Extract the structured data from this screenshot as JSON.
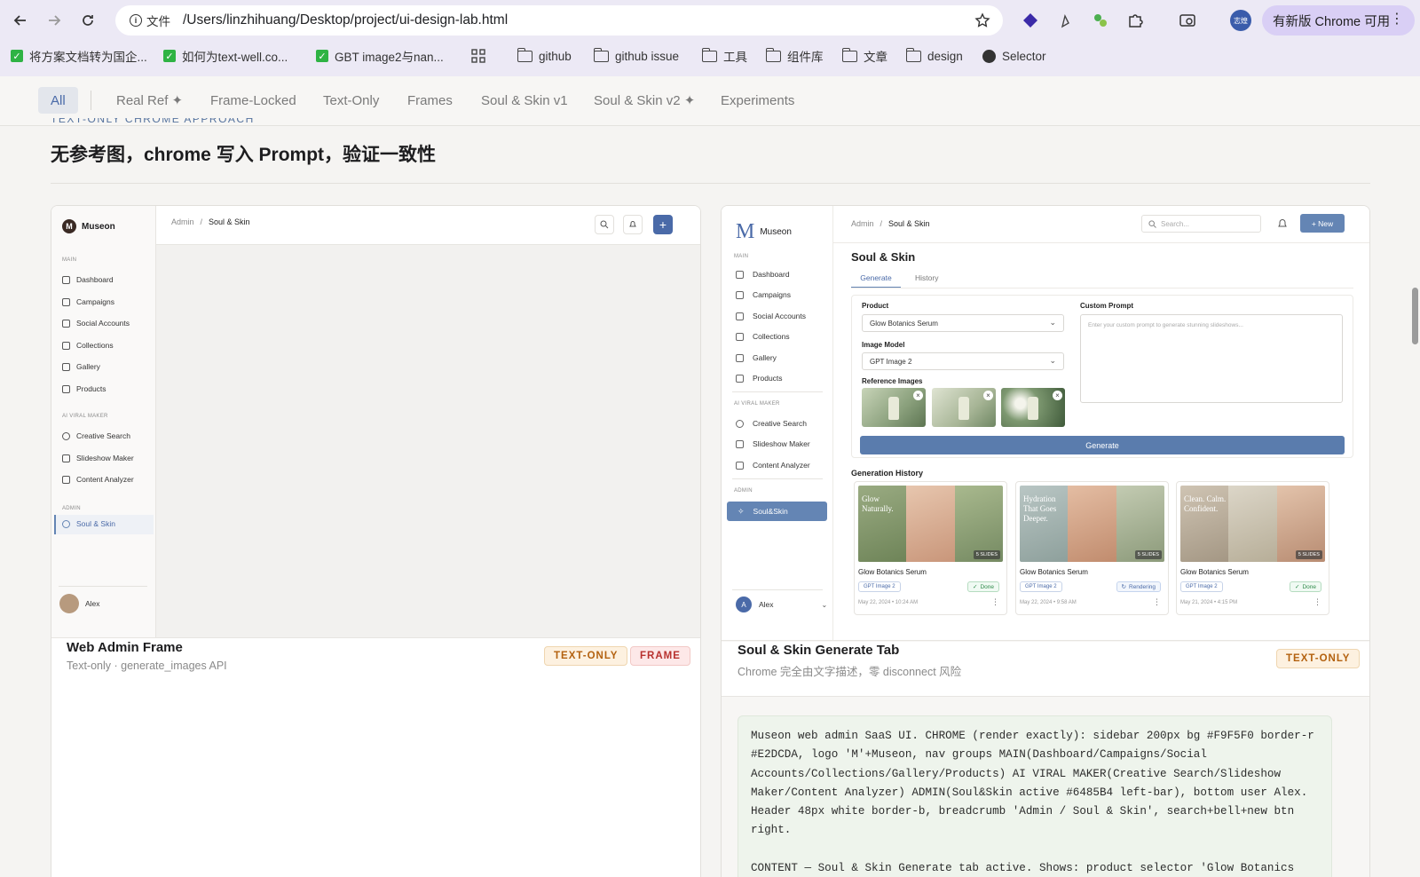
{
  "browser": {
    "info_label": "文件",
    "url": "/Users/linzhihuang/Desktop/project/ui-design-lab.html",
    "profile_initials": "志煌",
    "update_label": "有新版 Chrome 可用",
    "bookmarks": [
      {
        "label": "将方案文档转为国企...",
        "icon": "check-icon"
      },
      {
        "label": "如何为text-well.co...",
        "icon": "check-icon"
      },
      {
        "label": "GBT image2与nan...",
        "icon": "check-icon"
      },
      {
        "label": "github",
        "icon": "folder-icon"
      },
      {
        "label": "github issue",
        "icon": "folder-icon"
      },
      {
        "label": "工具",
        "icon": "folder-icon"
      },
      {
        "label": "组件库",
        "icon": "folder-icon"
      },
      {
        "label": "文章",
        "icon": "folder-icon"
      },
      {
        "label": "design",
        "icon": "folder-icon"
      },
      {
        "label": "Selector",
        "icon": "globe-icon"
      }
    ]
  },
  "filters": {
    "active": "All",
    "tabs": [
      "All",
      "Real Ref ✦",
      "Frame-Locked",
      "Text-Only",
      "Frames",
      "Soul & Skin v1",
      "Soul & Skin v2 ✦",
      "Experiments"
    ]
  },
  "section": {
    "eyebrow": "TEXT-ONLY CHROME APPROACH",
    "title": "无参考图，chrome 写入 Prompt，验证一致性"
  },
  "card1": {
    "title": "Web Admin Frame",
    "subtitle": "Text-only · generate_images API",
    "badges": [
      "TEXT-ONLY",
      "FRAME"
    ],
    "frame": {
      "logo_letter": "M",
      "logo": "Museon",
      "breadcrumb": [
        "Admin",
        "/",
        "Soul & Skin"
      ],
      "group_main": "MAIN",
      "main_items": [
        "Dashboard",
        "Campaigns",
        "Social Accounts",
        "Collections",
        "Gallery",
        "Products"
      ],
      "group_ai": "AI VIRAL MAKER",
      "ai_items": [
        "Creative Search",
        "Slideshow Maker",
        "Content Analyzer"
      ],
      "group_admin": "ADMIN",
      "admin_item": "Soul & Skin",
      "user": "Alex"
    }
  },
  "card2": {
    "title": "Soul & Skin Generate Tab",
    "subtitle": "Chrome 完全由文字描述，零 disconnect 风险",
    "badge": "TEXT-ONLY",
    "frame": {
      "logo_letter": "M",
      "logo": "Museon",
      "breadcrumb": [
        "Admin",
        "/",
        "Soul & Skin"
      ],
      "search_placeholder": "Search...",
      "new_button": "+ New",
      "group_main": "MAIN",
      "main_items": [
        "Dashboard",
        "Campaigns",
        "Social Accounts",
        "Collections",
        "Gallery",
        "Products"
      ],
      "group_ai": "AI VIRAL MAKER",
      "ai_items": [
        "Creative Search",
        "Slideshow Maker",
        "Content Analyzer"
      ],
      "group_admin": "ADMIN",
      "admin_item": "Soul&Skin",
      "user_initial": "A",
      "user": "Alex",
      "page_title": "Soul & Skin",
      "tabs": [
        "Generate",
        "History"
      ],
      "product_label": "Product",
      "product_value": "Glow Botanics Serum",
      "model_label": "Image Model",
      "model_value": "GPT Image 2",
      "ref_label": "Reference Images",
      "prompt_label": "Custom Prompt",
      "prompt_placeholder": "Enter your custom prompt to generate stunning slideshows...",
      "generate": "Generate",
      "history_title": "Generation History",
      "history": [
        {
          "overlay": "Glow Naturally.",
          "name": "Glow Botanics Serum",
          "model": "GPT Image 2",
          "status": "Done",
          "date": "May 22, 2024 • 10:24 AM",
          "slides": "5 SLIDES"
        },
        {
          "overlay": "Hydration That Goes Deeper.",
          "name": "Glow Botanics Serum",
          "model": "GPT Image 2",
          "status": "Rendering",
          "date": "May 22, 2024 • 9:58 AM",
          "slides": "5 SLIDES"
        },
        {
          "overlay": "Clean. Calm. Confident.",
          "name": "Glow Botanics Serum",
          "model": "GPT Image 2",
          "status": "Done",
          "date": "May 21, 2024 • 4:15 PM",
          "slides": "5 SLIDES"
        }
      ]
    },
    "prompt_text": "Museon web admin SaaS UI. CHROME (render exactly): sidebar 200px bg #F9F5F0 border-r #E2DCDA, logo 'M'+Museon, nav groups MAIN(Dashboard/Campaigns/Social Accounts/Collections/Gallery/Products) AI VIRAL MAKER(Creative Search/Slideshow Maker/Content Analyzer) ADMIN(Soul&Skin active #6485B4 left-bar), bottom user Alex. Header 48px white border-b, breadcrumb 'Admin / Soul & Skin', search+bell+new btn right.\n\nCONTENT — Soul & Skin Generate tab active. Shows: product selector 'Glow Botanics Serum'; prompt textarea; model selector 'GPT Image 2'; reference images row. 'Generate' btn bg"
  },
  "colors": {
    "accent": "#6485B4",
    "badge_text": "#B3610F",
    "badge_frame": "#B8322F"
  }
}
